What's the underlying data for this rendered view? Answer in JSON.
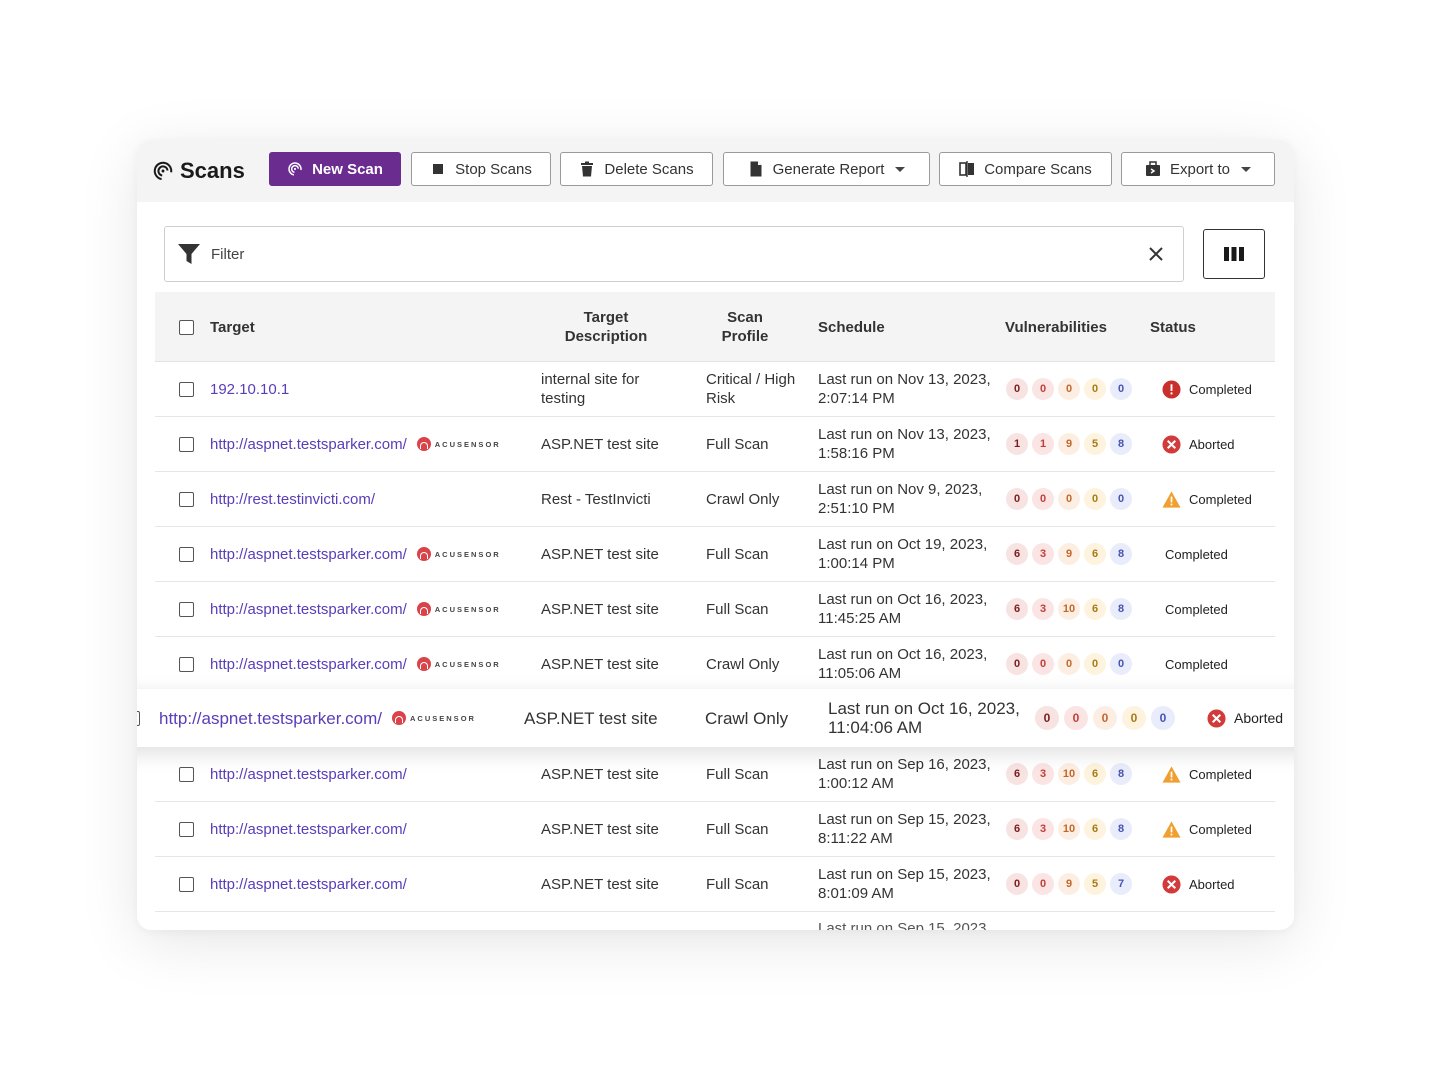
{
  "header": {
    "title": "Scans",
    "buttons": {
      "new_scan": "New Scan",
      "stop_scans": "Stop Scans",
      "delete_scans": "Delete Scans",
      "generate_report": "Generate Report",
      "compare_scans": "Compare Scans",
      "export_to": "Export to"
    }
  },
  "filter": {
    "placeholder": "Filter"
  },
  "columns": {
    "target": "Target",
    "description": "Target Description",
    "profile": "Scan Profile",
    "schedule": "Schedule",
    "vulnerabilities": "Vulnerabilities",
    "status": "Status"
  },
  "acusensor_label": "ACUSENSOR",
  "rows": [
    {
      "target": "192.10.10.1",
      "acusensor": false,
      "description": "internal site for testing",
      "profile": "Critical / High Risk",
      "schedule": "Last run on Nov 13, 2023, 2:07:14 PM",
      "vulns": [
        0,
        0,
        0,
        0,
        0
      ],
      "status": "Completed",
      "status_icon": "error-icon"
    },
    {
      "target": "http://aspnet.testsparker.com/",
      "acusensor": true,
      "description": "ASP.NET test site",
      "profile": "Full Scan",
      "schedule": "Last run on Nov 13, 2023, 1:58:16 PM",
      "vulns": [
        1,
        1,
        9,
        5,
        8
      ],
      "status": "Aborted",
      "status_icon": "aborted-icon"
    },
    {
      "target": "http://rest.testinvicti.com/",
      "acusensor": false,
      "description": "Rest - TestInvicti",
      "profile": "Crawl Only",
      "schedule": "Last run on Nov 9, 2023, 2:51:10 PM",
      "vulns": [
        0,
        0,
        0,
        0,
        0
      ],
      "status": "Completed",
      "status_icon": "warning-icon"
    },
    {
      "target": "http://aspnet.testsparker.com/",
      "acusensor": true,
      "description": "ASP.NET test site",
      "profile": "Full Scan",
      "schedule": "Last run on Oct 19, 2023, 1:00:14 PM",
      "vulns": [
        6,
        3,
        9,
        6,
        8
      ],
      "status": "Completed",
      "status_icon": "none"
    },
    {
      "target": "http://aspnet.testsparker.com/",
      "acusensor": true,
      "description": "ASP.NET test site",
      "profile": "Full Scan",
      "schedule": "Last run on Oct 16, 2023, 11:45:25 AM",
      "vulns": [
        6,
        3,
        10,
        6,
        8
      ],
      "status": "Completed",
      "status_icon": "none"
    },
    {
      "target": "http://aspnet.testsparker.com/",
      "acusensor": true,
      "description": "ASP.NET test site",
      "profile": "Crawl Only",
      "schedule": "Last run on Oct 16, 2023, 11:05:06 AM",
      "vulns": [
        0,
        0,
        0,
        0,
        0
      ],
      "status": "Completed",
      "status_icon": "none"
    },
    {
      "target": "http://aspnet.testsparker.com/",
      "acusensor": true,
      "description": "ASP.NET test site",
      "profile": "Crawl Only",
      "schedule": "Last run on Oct 16, 2023, 11:04:06 AM",
      "vulns": [
        0,
        0,
        0,
        0,
        0
      ],
      "status": "Aborted",
      "status_icon": "aborted-icon",
      "highlighted": true
    },
    {
      "target": "http://aspnet.testsparker.com/",
      "acusensor": false,
      "description": "ASP.NET test site",
      "profile": "Full Scan",
      "schedule": "Last run on Sep 16, 2023, 1:00:12 AM",
      "vulns": [
        6,
        3,
        10,
        6,
        8
      ],
      "status": "Completed",
      "status_icon": "warning-icon"
    },
    {
      "target": "http://aspnet.testsparker.com/",
      "acusensor": false,
      "description": "ASP.NET test site",
      "profile": "Full Scan",
      "schedule": "Last run on Sep 15, 2023, 8:11:22 AM",
      "vulns": [
        6,
        3,
        10,
        6,
        8
      ],
      "status": "Completed",
      "status_icon": "warning-icon"
    },
    {
      "target": "http://aspnet.testsparker.com/",
      "acusensor": false,
      "description": "ASP.NET test site",
      "profile": "Full Scan",
      "schedule": "Last run on Sep 15, 2023, 8:01:09 AM",
      "vulns": [
        0,
        0,
        9,
        5,
        7
      ],
      "status": "Aborted",
      "status_icon": "aborted-icon"
    }
  ],
  "partial_row_schedule": "Last run on Sep 15, 2023",
  "colors": {
    "primary": "#6b2c8f",
    "link": "#5a3db8",
    "error": "#c9302c",
    "warning": "#f0a030"
  }
}
